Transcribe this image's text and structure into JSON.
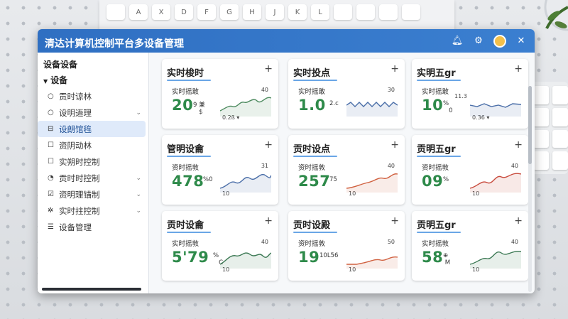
{
  "window": {
    "title": "清达计算机控制平台多设备管理"
  },
  "keyboard_keys": [
    "",
    "A",
    "X",
    "D",
    "F",
    "G",
    "H",
    "J",
    "K",
    "L",
    "",
    "",
    "",
    ""
  ],
  "sidebar": {
    "header": "设备设备",
    "group": "设备",
    "items": [
      {
        "label": "贡时谅林",
        "icon": "circle-icon",
        "glyph": "○",
        "chevron": ""
      },
      {
        "label": "设明逜理",
        "icon": "circle-icon",
        "glyph": "○",
        "chevron": "⌄"
      },
      {
        "label": "设朗馆毪",
        "icon": "minus-square-icon",
        "glyph": "⊟",
        "chevron": "",
        "active": true
      },
      {
        "label": "资阴动林",
        "icon": "square-icon",
        "glyph": "☐",
        "chevron": ""
      },
      {
        "label": "实朔时控制",
        "icon": "square-icon",
        "glyph": "☐",
        "chevron": ""
      },
      {
        "label": "贡时时控制",
        "icon": "gauge-icon",
        "glyph": "◔",
        "chevron": "⌄"
      },
      {
        "label": "资明理锚制",
        "icon": "check-square-icon",
        "glyph": "☑",
        "chevron": "⌄"
      },
      {
        "label": "实时拄控制",
        "icon": "gear-icon",
        "glyph": "✲",
        "chevron": "⌄"
      },
      {
        "label": "设备管理",
        "icon": "list-icon",
        "glyph": "☰",
        "chevron": ""
      }
    ]
  },
  "cards": [
    {
      "title": "实时梭时",
      "sub": "实时摇敢",
      "value": "20",
      "unit": "9 兼\n   $",
      "hi": "40",
      "lo": "0.2ß ▾",
      "color": "#4c8a5e"
    },
    {
      "title": "实时投点",
      "sub": "实时摇敢",
      "value": "1.0",
      "unit": "2.c",
      "hi": "30",
      "lo": "",
      "color": "#4a6ea8"
    },
    {
      "title": "实明五gr",
      "sub": "实时摇敢",
      "value": "10",
      "unit": "%\n   0",
      "hi": "",
      "lo": "0.36 ▾",
      "color": "#4a6ea8",
      "hi2": "11.3"
    },
    {
      "title": "管明设龠",
      "sub": "资时摇敦",
      "value": "478",
      "unit": "%0",
      "hi": "31",
      "lo": "10",
      "color": "#4a6ea8"
    },
    {
      "title": "贡时设点",
      "sub": "资时摇敦",
      "value": "257",
      "unit": "75",
      "hi": "40",
      "lo": "10",
      "color": "#d0603f"
    },
    {
      "title": "贡明五gr",
      "sub": "资时摇敦",
      "value": "09",
      "unit": "%",
      "hi": "40",
      "lo": "10",
      "color": "#c84a3c"
    },
    {
      "title": "贡时设龠",
      "sub": "实时摇敦",
      "value": "5'79",
      "unit": "%\n   C",
      "hi": "40",
      "lo": "10",
      "color": "#3d7a55"
    },
    {
      "title": "贡时设殿",
      "sub": "资时摇敦",
      "value": "19",
      "unit": "10L56",
      "hi": "50",
      "lo": "10",
      "color": "#d0603f"
    },
    {
      "title": "贡明五gr",
      "sub": "实时摇敦",
      "value": "58",
      "unit": "⊕\n M",
      "hi": "40",
      "lo": "10",
      "color": "#3d7a55"
    }
  ]
}
